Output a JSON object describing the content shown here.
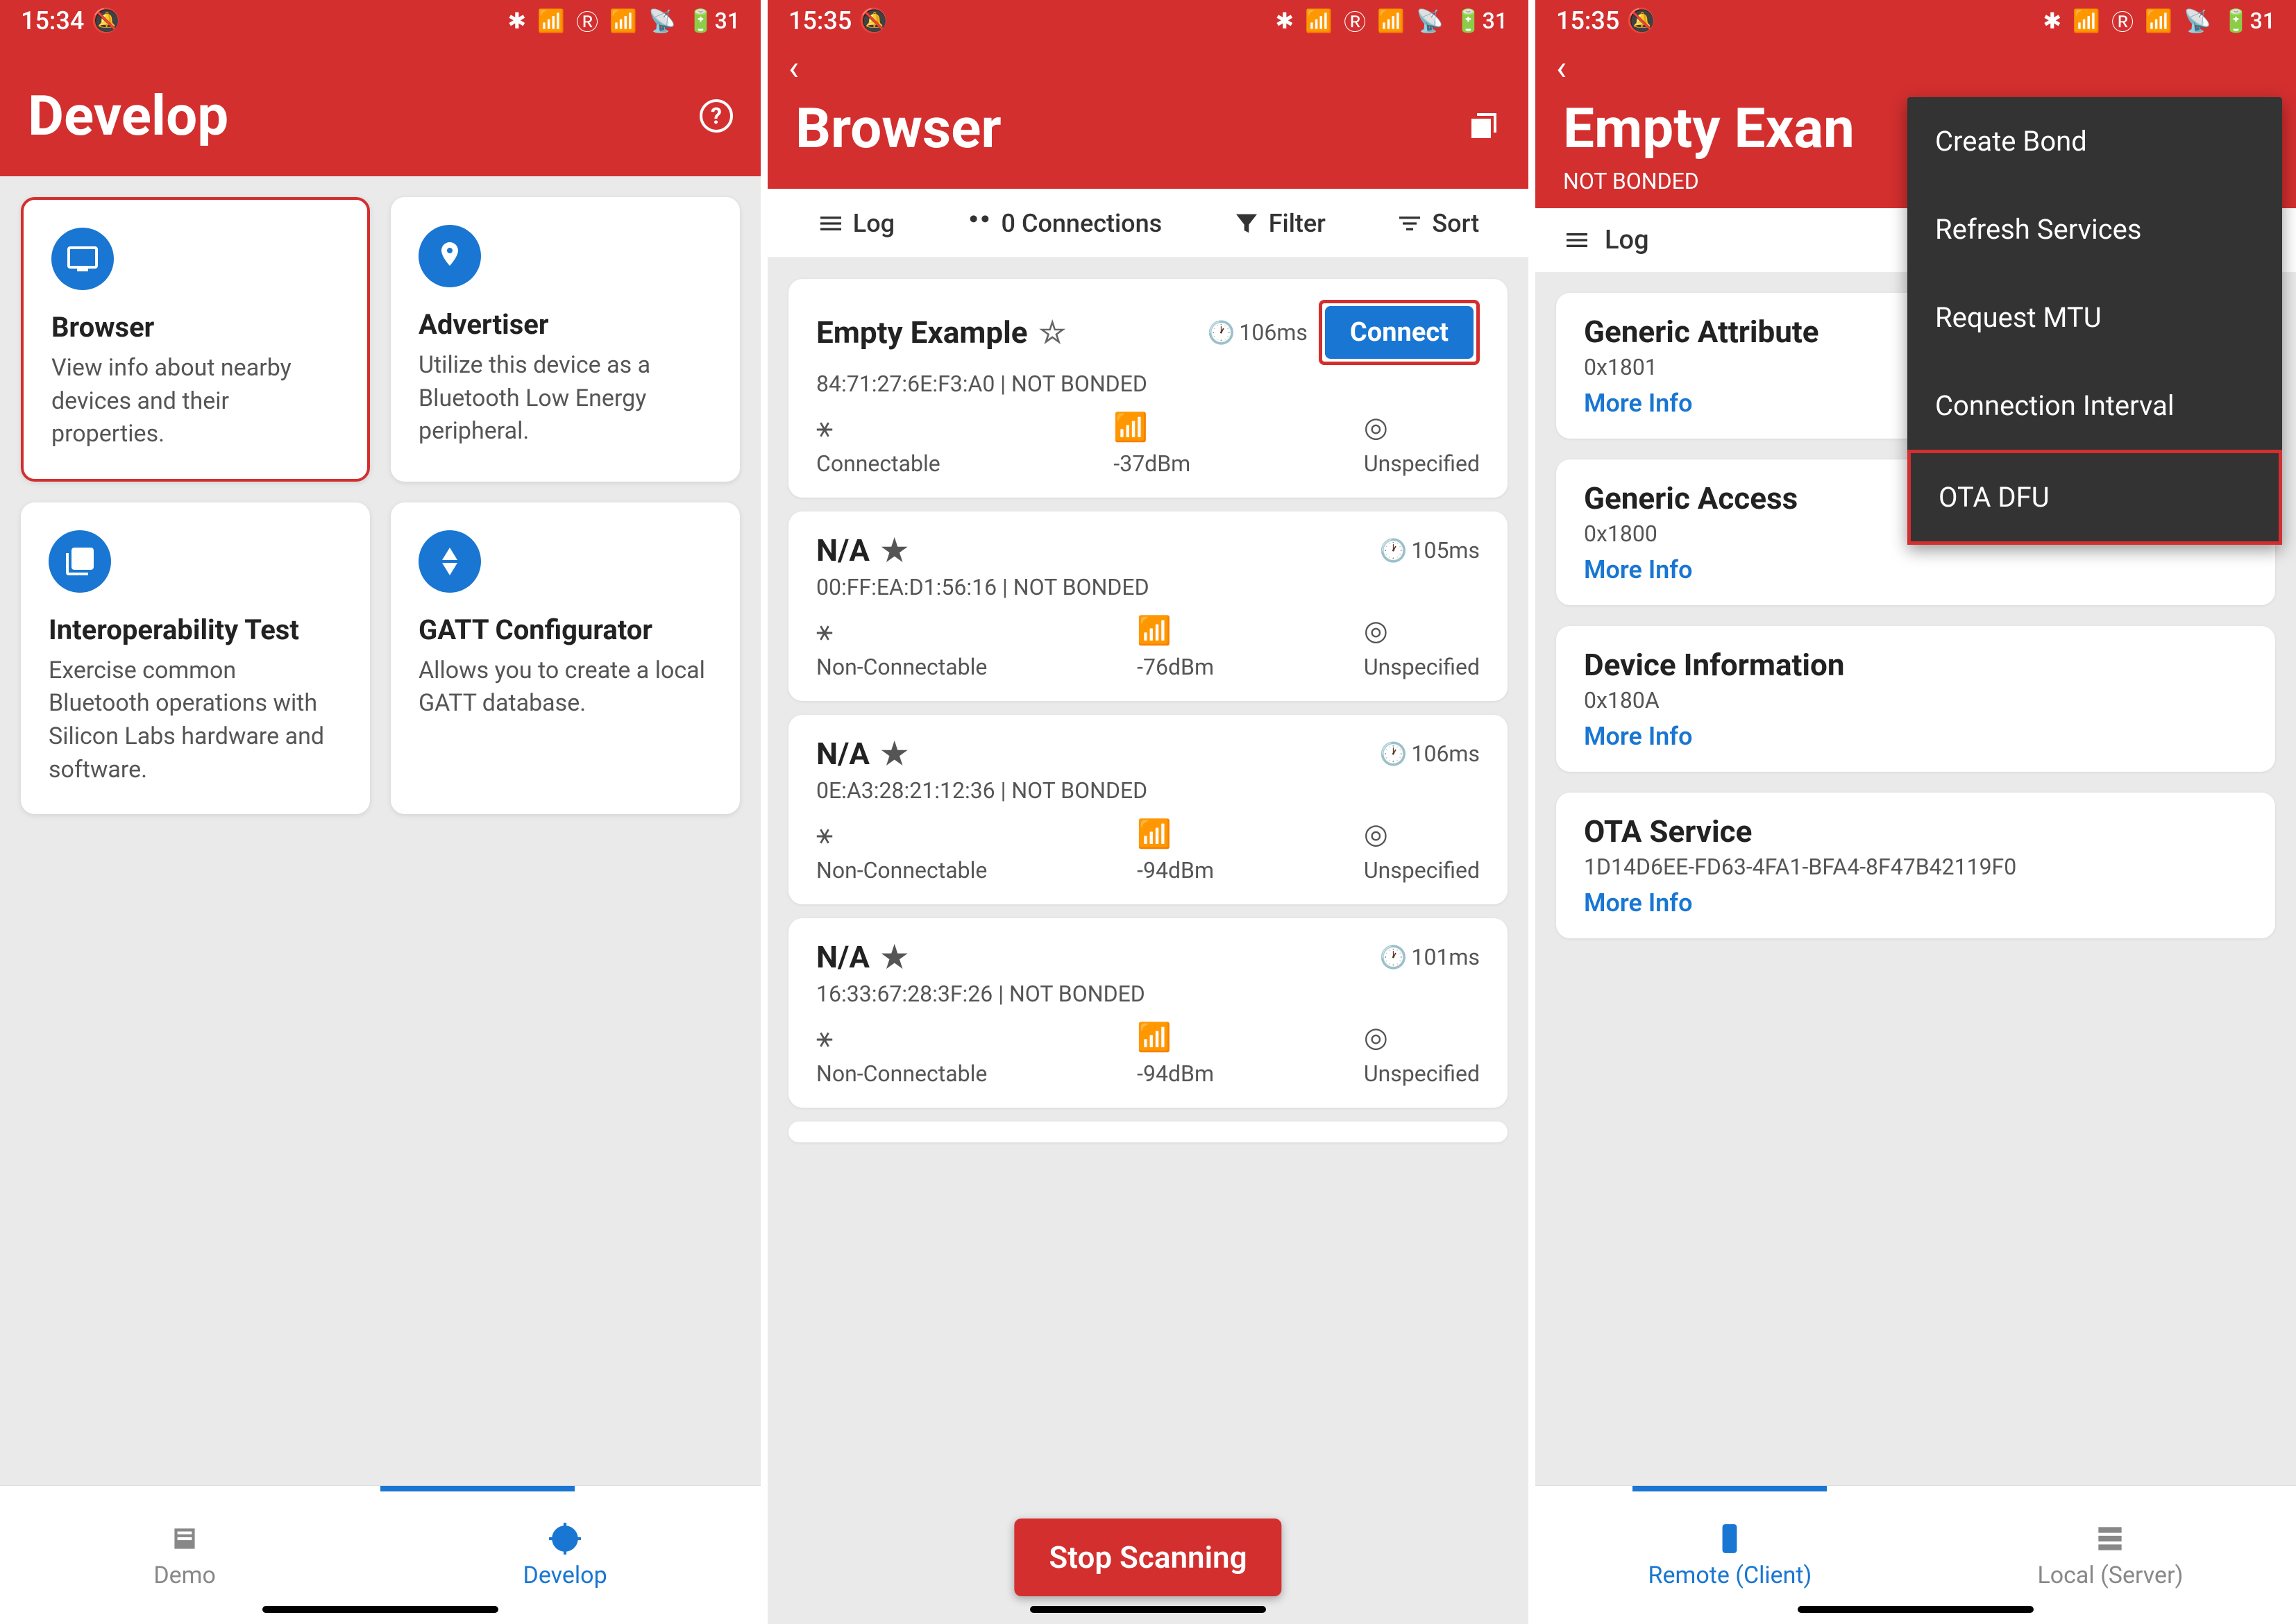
{
  "status": {
    "time1": "15:34",
    "time2": "15:35",
    "time3": "15:35",
    "battery": "31"
  },
  "screen1": {
    "title": "Develop",
    "cards": [
      {
        "title": "Browser",
        "desc": "View info about nearby devices and their properties.",
        "highlighted": true
      },
      {
        "title": "Advertiser",
        "desc": "Utilize this device as a Bluetooth Low Energy peripheral."
      },
      {
        "title": "Interoperability Test",
        "desc": "Exercise common Bluetooth operations with Silicon Labs hardware and software."
      },
      {
        "title": "GATT Configurator",
        "desc": "Allows you to create a local GATT database."
      }
    ],
    "nav": {
      "demo": "Demo",
      "develop": "Develop"
    }
  },
  "screen2": {
    "title": "Browser",
    "toolbar": {
      "log": "Log",
      "connections": "0 Connections",
      "filter": "Filter",
      "sort": "Sort"
    },
    "devices": [
      {
        "name": "Empty Example",
        "starred": false,
        "time": "106ms",
        "mac": "84:71:27:6E:F3:A0 | NOT BONDED",
        "connectable": "Connectable",
        "rssi": "-37dBm",
        "dist": "Unspecified",
        "connect": "Connect",
        "highlighted": true
      },
      {
        "name": "N/A",
        "starred": true,
        "time": "105ms",
        "mac": "00:FF:EA:D1:56:16 | NOT BONDED",
        "connectable": "Non-Connectable",
        "rssi": "-76dBm",
        "dist": "Unspecified"
      },
      {
        "name": "N/A",
        "starred": true,
        "time": "106ms",
        "mac": "0E:A3:28:21:12:36 | NOT BONDED",
        "connectable": "Non-Connectable",
        "rssi": "-94dBm",
        "dist": "Unspecified"
      },
      {
        "name": "N/A",
        "starred": true,
        "time": "101ms",
        "mac": "16:33:67:28:3F:26 | NOT BONDED",
        "connectable": "Non-Connectable",
        "rssi": "-94dBm",
        "dist": "Unspecified"
      }
    ],
    "stop": "Stop Scanning"
  },
  "screen3": {
    "title": "Empty Exan",
    "bond": "NOT BONDED",
    "log": "Log",
    "services": [
      {
        "title": "Generic Attribute",
        "uuid": "0x1801",
        "more": "More Info"
      },
      {
        "title": "Generic Access",
        "uuid": "0x1800",
        "more": "More Info"
      },
      {
        "title": "Device Information",
        "uuid": "0x180A",
        "more": "More Info"
      },
      {
        "title": "OTA Service",
        "uuid": "1D14D6EE-FD63-4FA1-BFA4-8F47B42119F0",
        "more": "More Info"
      }
    ],
    "menu": [
      "Create Bond",
      "Refresh Services",
      "Request MTU",
      "Connection Interval",
      "OTA DFU"
    ],
    "nav": {
      "remote": "Remote (Client)",
      "local": "Local (Server)"
    }
  }
}
